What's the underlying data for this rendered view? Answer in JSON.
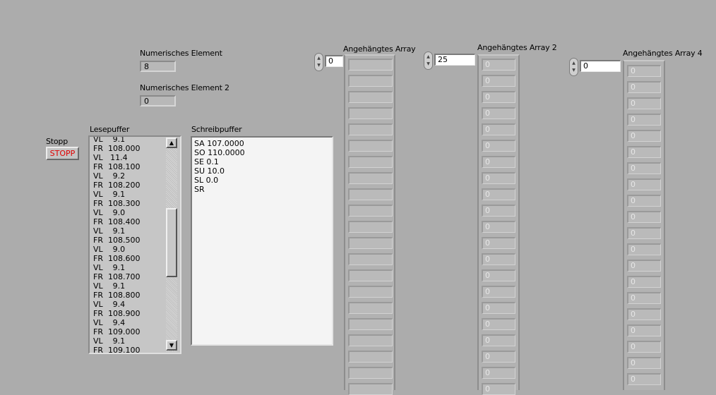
{
  "numerisches_element": {
    "label": "Numerisches Element",
    "value": "8"
  },
  "numerisches_element_2": {
    "label": "Numerisches Element 2",
    "value": "0"
  },
  "stopp": {
    "label": "Stopp",
    "button_text": "STOPP",
    "button_color": "#e00000"
  },
  "lesepuffer": {
    "label": "Lesepuffer",
    "text": "VL    9.1\nFR  108.000\nVL   11.4\nFR  108.100\nVL    9.2\nFR  108.200\nVL    9.1\nFR  108.300\nVL    9.0\nFR  108.400\nVL    9.1\nFR  108.500\nVL    9.0\nFR  108.600\nVL    9.1\nFR  108.700\nVL    9.1\nFR  108.800\nVL    9.4\nFR  108.900\nVL    9.4\nFR  109.000\nVL    9.1\nFR  109.100",
    "scroll_up_icon": "arrow-up-icon",
    "scroll_down_icon": "arrow-down-icon"
  },
  "schreibpuffer": {
    "label": "Schreibpuffer",
    "text": "SA 107.0000\nSO 110.0000\nSE 0.1\nSU 10.0\nSL 0.0\nSR"
  },
  "arrays": [
    {
      "label": "Angehängtes Array",
      "index": "0",
      "cell_value": ""
    },
    {
      "label": "Angehängtes Array 2",
      "index": "25",
      "cell_value": "0"
    },
    {
      "label": "Angehängtes Array 4",
      "index": "0",
      "cell_value": "0"
    }
  ],
  "colors": {
    "panel_background": "#acacac",
    "stop_text": "#e00000"
  }
}
